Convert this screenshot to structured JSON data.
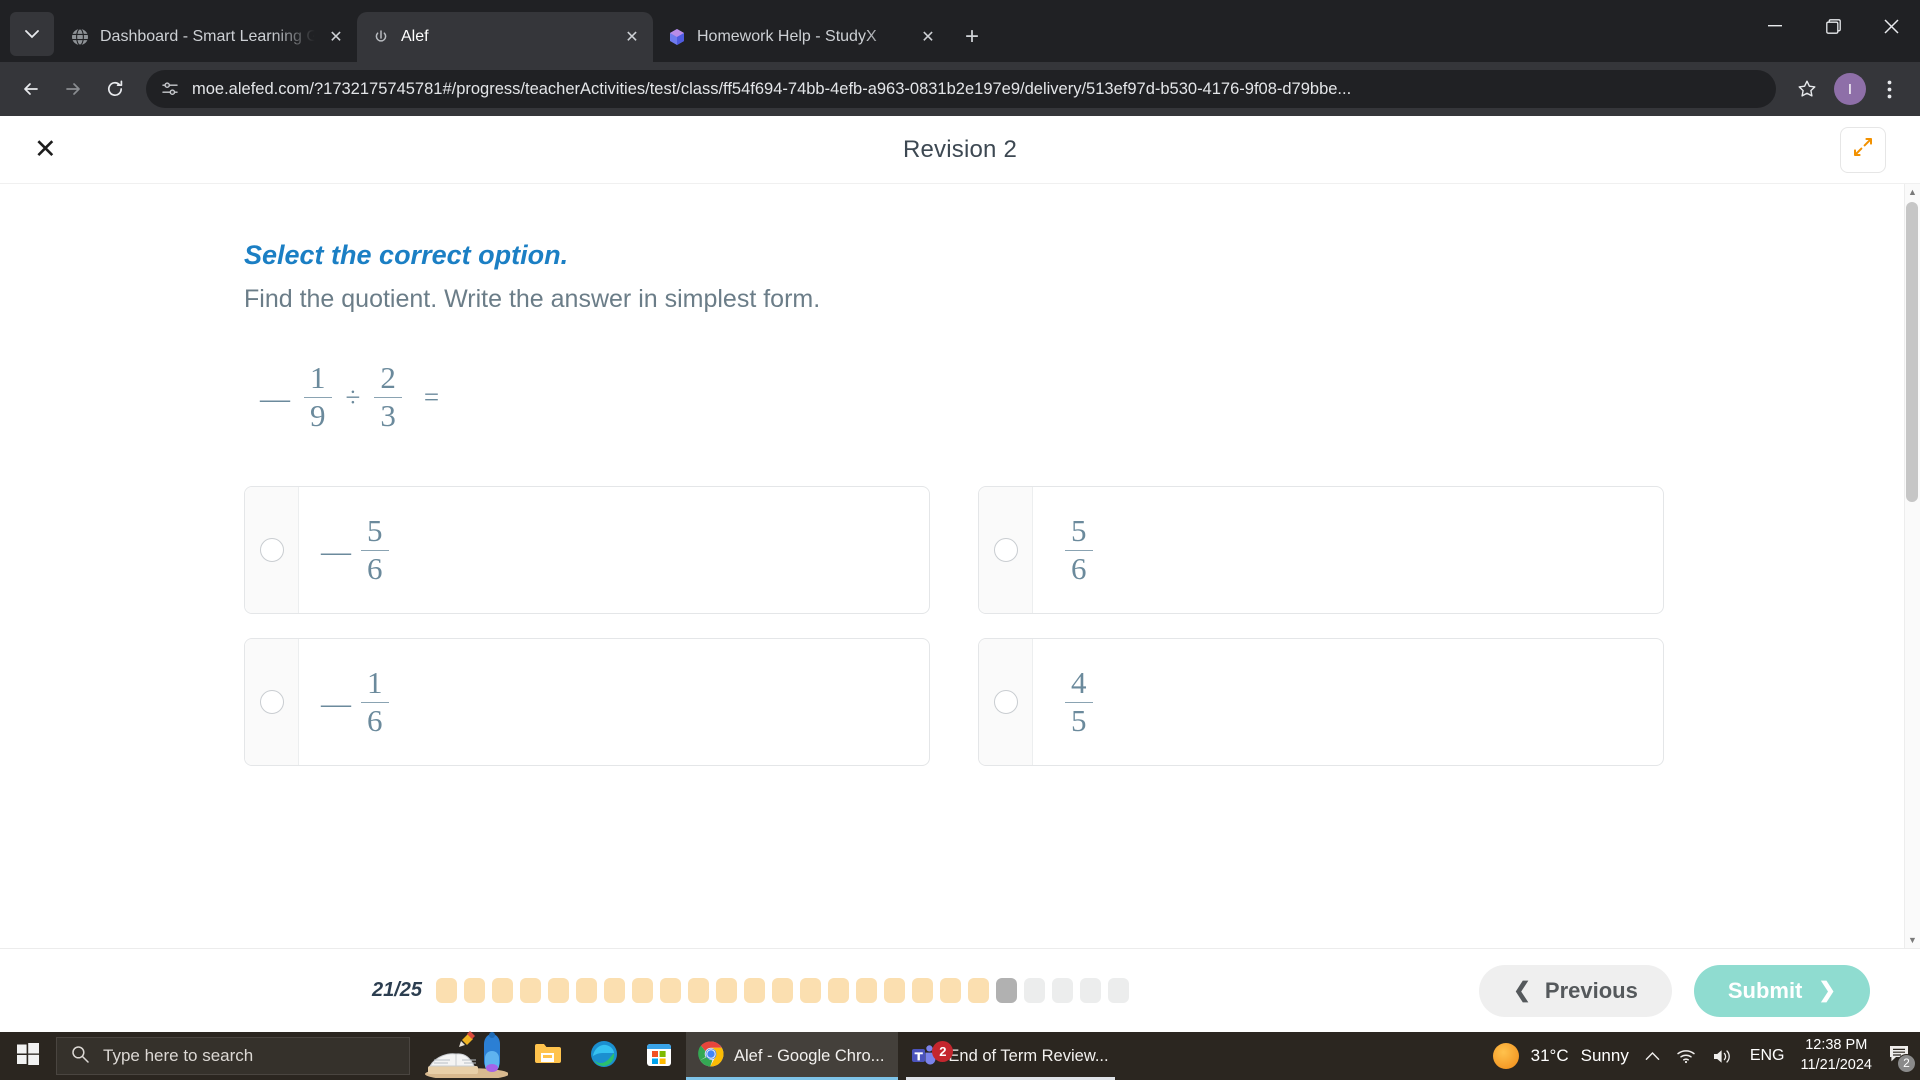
{
  "browser": {
    "tabs": [
      {
        "title": "Dashboard - Smart Learning Ga",
        "favicon": "globe-icon",
        "active": false
      },
      {
        "title": "Alef",
        "favicon": "alef-icon",
        "active": true
      },
      {
        "title": "Homework Help - StudyX",
        "favicon": "studyx-icon",
        "active": false
      }
    ],
    "new_tab_label": "+",
    "tab_list_icon": "chevron-down-icon",
    "window_controls": {
      "minimize": "minimize-icon",
      "maximize": "restore-icon",
      "close": "close-icon"
    },
    "toolbar": {
      "back": "back-arrow-icon",
      "forward": "forward-arrow-icon",
      "reload": "reload-icon",
      "site_info": "site-settings-icon",
      "url": "moe.alefed.com/?1732175745781#/progress/teacherActivities/test/class/ff54f694-74bb-4efb-a963-0831b2e197e9/delivery/513ef97d-b530-4176-9f08-d79bbe...",
      "bookmark": "star-icon",
      "profile_initial": "I",
      "menu": "kebab-menu-icon"
    }
  },
  "app": {
    "close_label": "✕",
    "title": "Revision 2",
    "expand_icon": "expand-arrows-icon"
  },
  "question": {
    "prompt": "Select the correct option.",
    "instruction": "Find the quotient. Write the answer in simplest form.",
    "expression": {
      "sign": "—",
      "first": {
        "numerator": "1",
        "denominator": "9"
      },
      "operator": "÷",
      "second": {
        "numerator": "2",
        "denominator": "3"
      },
      "equals": "="
    },
    "options": [
      {
        "id": "a",
        "sign": "—",
        "numerator": "5",
        "denominator": "6",
        "selected": false
      },
      {
        "id": "b",
        "sign": "",
        "numerator": "5",
        "denominator": "6",
        "selected": false
      },
      {
        "id": "c",
        "sign": "—",
        "numerator": "1",
        "denominator": "6",
        "selected": false
      },
      {
        "id": "d",
        "sign": "",
        "numerator": "4",
        "denominator": "5",
        "selected": false
      }
    ]
  },
  "footer": {
    "progress_label": "21/25",
    "current_index": 21,
    "total": 25,
    "done_count": 20,
    "previous_label": "Previous",
    "previous_chevron": "❮",
    "submit_label": "Submit",
    "submit_chevron": "❯"
  },
  "taskbar": {
    "start_icon": "windows-logo-icon",
    "search_placeholder": "Type here to search",
    "search_icon": "search-icon",
    "pinned": [
      {
        "name": "file-explorer-icon"
      },
      {
        "name": "microsoft-edge-icon"
      },
      {
        "name": "microsoft-store-icon"
      }
    ],
    "windows": [
      {
        "icon": "chrome-icon",
        "label": "Alef - Google Chro...",
        "active": true,
        "badge": ""
      },
      {
        "icon": "teams-icon",
        "label": "End of Term Review...",
        "active": false,
        "badge": "2"
      }
    ],
    "tray": {
      "weather_icon": "sun-icon",
      "temperature": "31°C",
      "condition": "Sunny",
      "overflow_icon": "chevron-up-icon",
      "network_icon": "wifi-icon",
      "volume_icon": "speaker-icon",
      "language": "ENG",
      "time": "12:38 PM",
      "date": "11/21/2024",
      "notification_icon": "notification-icon",
      "notification_count": "2"
    }
  },
  "colors": {
    "accent_blue": "#1b7fc4",
    "submit_teal": "#8fdcd0",
    "progress_done": "#fbdfb0",
    "progress_current": "#b1b1b1",
    "progress_todo": "#eceded",
    "math_text": "#6b8a9c"
  }
}
